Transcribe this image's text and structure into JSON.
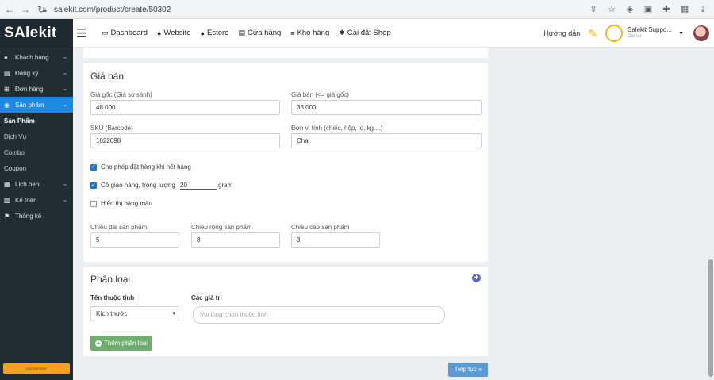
{
  "browser": {
    "url": "salekit.com/product/create/50302"
  },
  "sidebar": {
    "logo_s": "S",
    "logo_a": "A",
    "logo_rest": "lekit",
    "items": [
      {
        "label": "Khách hàng",
        "icon": "user-icon"
      },
      {
        "label": "Đăng ký",
        "icon": "card-icon"
      },
      {
        "label": "Đơn hàng",
        "icon": "cart-icon"
      },
      {
        "label": "Sản phẩm",
        "icon": "box-icon"
      },
      {
        "label": "Lịch hẹn",
        "icon": "calendar-icon"
      },
      {
        "label": "Kế toán",
        "icon": "calculator-icon"
      },
      {
        "label": "Thống kê",
        "icon": "flag-icon"
      }
    ],
    "subitems": [
      "Sản Phẩm",
      "Dịch Vụ",
      "Combo",
      "Coupon"
    ],
    "footer_badge": "ENTERPRISE"
  },
  "topnav": {
    "items": [
      "Dashboard",
      "Website",
      "Estore",
      "Cửa hàng",
      "Kho hàng",
      "Cài đặt Shop"
    ],
    "guide": "Hướng dẫn",
    "user_name": "Salekit Suppo...",
    "user_role": "Owner"
  },
  "price_card": {
    "title": "Giá bán",
    "orig_price_label": "Giá gốc (Giá so sánh)",
    "orig_price_value": "48.000",
    "sale_price_label": "Giá bán (<= giá gốc)",
    "sale_price_value": "35.000",
    "sku_label": "SKU (Barcode)",
    "sku_value": "1022098",
    "unit_label": "Đơn vị tính (chiếc, hộp, lọ, kg....)",
    "unit_value": "Chai",
    "cb_oos": "Cho phép đặt hàng khi hết hàng",
    "cb_ship": "Có giao hàng, trọng lượng",
    "weight_value": "20",
    "weight_unit": "gram",
    "cb_color": "Hiển thị bảng màu",
    "length_label": "Chiều dài sản phẩm",
    "length_value": "5",
    "width_label": "Chiều rộng sản phẩm",
    "width_value": "8",
    "height_label": "Chiều cao sản phẩm",
    "height_value": "3"
  },
  "class_card": {
    "title": "Phân loại",
    "attr_label": "Tên thuộc tính",
    "attr_value": "Kích thước",
    "values_label": "Các giá trị",
    "values_placeholder": "Vui lòng chọn thuộc tính",
    "add_btn": "Thêm phân loại"
  },
  "next_btn": "Tiếp tục »",
  "colors": {
    "sidebar": "#222d32",
    "accent": "#1e88e5",
    "add_green": "#6fad6f"
  }
}
